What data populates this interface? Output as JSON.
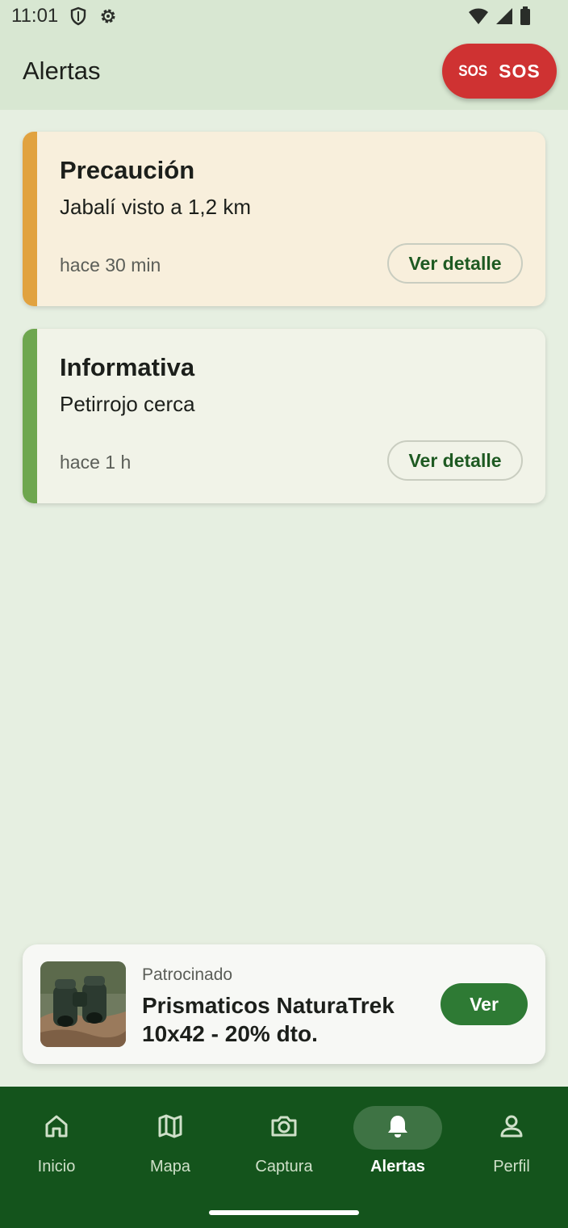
{
  "status_bar": {
    "time": "11:01"
  },
  "app_bar": {
    "title": "Alertas",
    "sos_badge": "SOS",
    "sos_label": "SOS"
  },
  "alerts": [
    {
      "level": "Precaución",
      "message": "Jabalí visto a 1,2 km",
      "time": "hace 30 min",
      "button": "Ver detalle",
      "accent": "#e1a23f"
    },
    {
      "level": "Informativa",
      "message": "Petirrojo cerca",
      "time": "hace 1 h",
      "button": "Ver detalle",
      "accent": "#6ea64f"
    }
  ],
  "ad": {
    "sponsored": "Patrocinado",
    "title": "Prismaticos NaturaTrek 10x42 - 20% dto.",
    "button": "Ver",
    "image_icon": "binoculars-photo"
  },
  "nav": {
    "items": [
      {
        "label": "Inicio",
        "icon": "home-icon"
      },
      {
        "label": "Mapa",
        "icon": "map-icon"
      },
      {
        "label": "Captura",
        "icon": "camera-icon"
      },
      {
        "label": "Alertas",
        "icon": "bell-icon",
        "active": true
      },
      {
        "label": "Perfil",
        "icon": "person-icon"
      }
    ]
  },
  "colors": {
    "primary": "#14541c",
    "sos": "#cf3232",
    "accent_green": "#2e7a34"
  }
}
